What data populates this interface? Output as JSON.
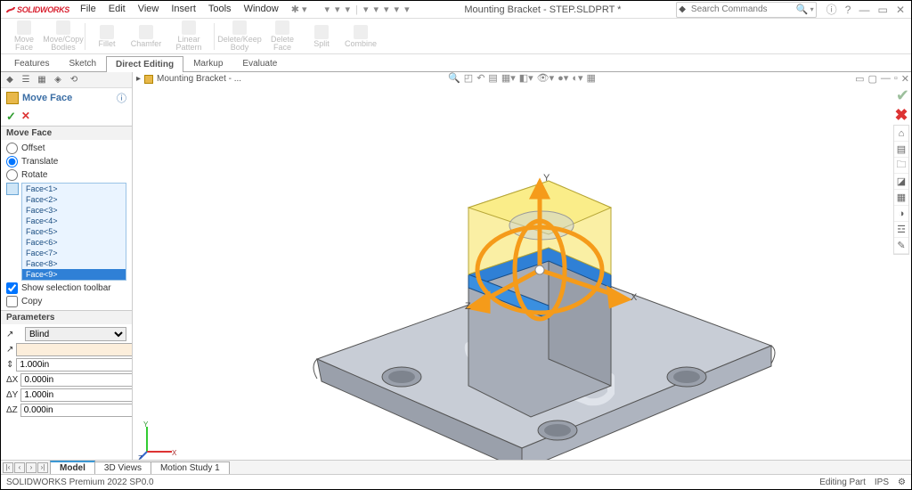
{
  "app": {
    "name": "SOLIDWORKS",
    "document_title": "Mounting Bracket - STEP.SLDPRT *"
  },
  "menu": [
    "File",
    "Edit",
    "View",
    "Insert",
    "Tools",
    "Window"
  ],
  "search": {
    "placeholder": "Search Commands"
  },
  "ribbon": {
    "buttons": [
      {
        "label": "Move\nFace"
      },
      {
        "label": "Move/Copy\nBodies"
      },
      {
        "label": "Fillet"
      },
      {
        "label": "Chamfer"
      },
      {
        "label": "Linear Pattern"
      },
      {
        "label": "Delete/Keep\nBody"
      },
      {
        "label": "Delete\nFace"
      },
      {
        "label": "Split"
      },
      {
        "label": "Combine"
      }
    ]
  },
  "tabs": {
    "items": [
      "Features",
      "Sketch",
      "Direct Editing",
      "Markup",
      "Evaluate"
    ],
    "active": "Direct Editing"
  },
  "crumb": "Mounting Bracket - ...",
  "pm": {
    "title": "Move Face",
    "section1": "Move Face",
    "options": {
      "offset": "Offset",
      "translate": "Translate",
      "rotate": "Rotate"
    },
    "faces": [
      "Face<1>",
      "Face<2>",
      "Face<3>",
      "Face<4>",
      "Face<5>",
      "Face<6>",
      "Face<7>",
      "Face<8>",
      "Face<9>"
    ],
    "selected_face_index": 8,
    "show_sel_toolbar": "Show selection toolbar",
    "copy": "Copy",
    "section2": "Parameters",
    "end_condition": "Blind",
    "dist": "1.000in",
    "vals": {
      "dx": "0.000in",
      "dy": "1.000in",
      "dz": "0.000in"
    },
    "labels": {
      "dx": "ΔX",
      "dy": "ΔY",
      "dz": "ΔZ"
    }
  },
  "bottom_tabs": [
    "Model",
    "3D Views",
    "Motion Study 1"
  ],
  "status": {
    "left": "SOLIDWORKS Premium 2022 SP0.0",
    "mode": "Editing Part",
    "units": "IPS"
  }
}
